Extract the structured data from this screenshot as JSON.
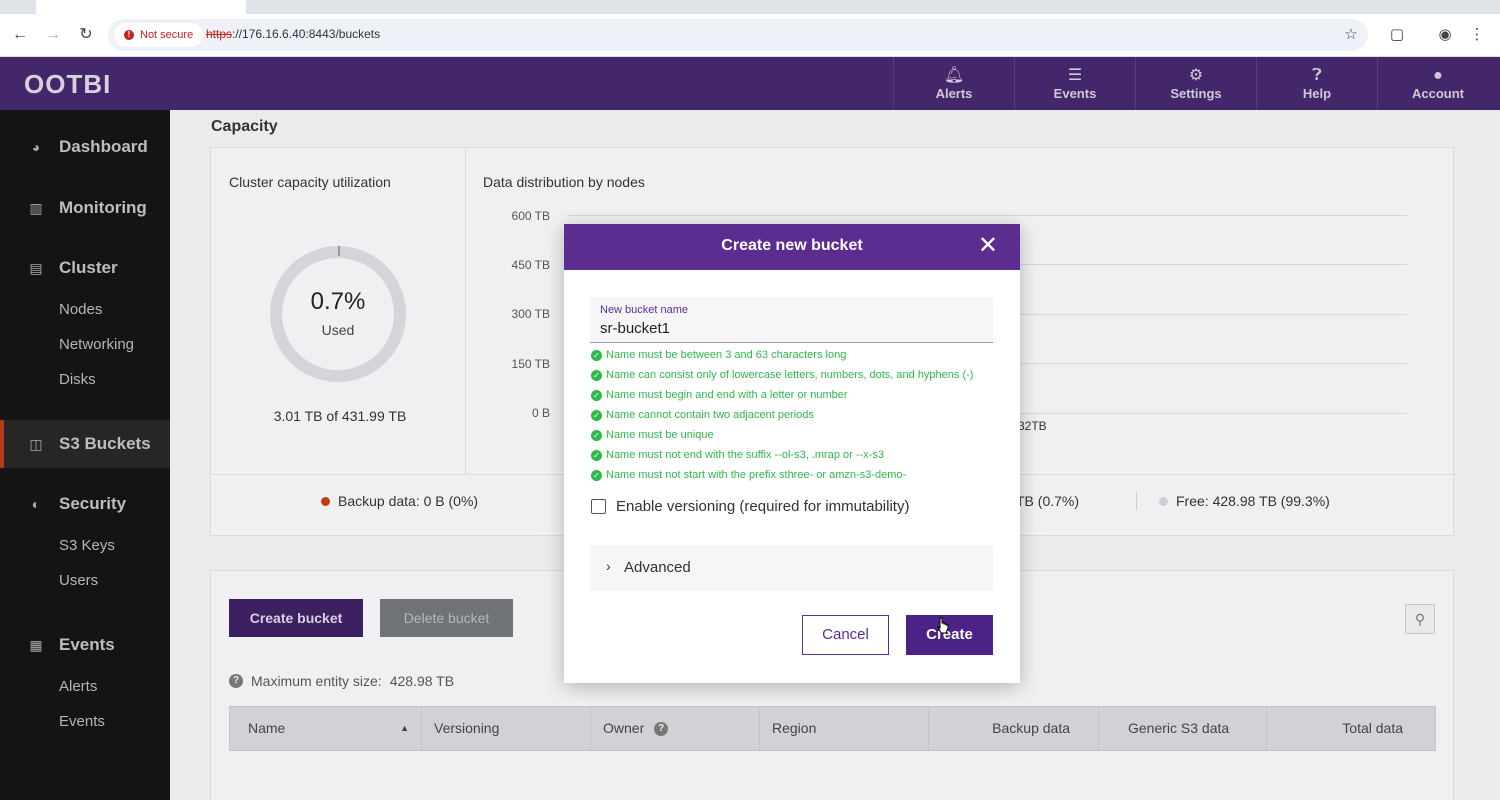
{
  "browser": {
    "not_secure": "Not secure",
    "url_scheme": "https",
    "url_rest": "://176.16.6.40:8443/buckets"
  },
  "app": {
    "logo": "OOTBI",
    "header_items": [
      {
        "label": "Alerts",
        "icon": "bell-icon"
      },
      {
        "label": "Events",
        "icon": "list-icon"
      },
      {
        "label": "Settings",
        "icon": "gear-icon"
      },
      {
        "label": "Help",
        "icon": "help-icon"
      },
      {
        "label": "Account",
        "icon": "user-icon"
      }
    ]
  },
  "sidebar": {
    "dashboard": "Dashboard",
    "monitoring": "Monitoring",
    "cluster": "Cluster",
    "nodes": "Nodes",
    "networking": "Networking",
    "disks": "Disks",
    "s3_buckets": "S3 Buckets",
    "security": "Security",
    "s3_keys": "S3 Keys",
    "users": "Users",
    "events": "Events",
    "alerts": "Alerts",
    "events_sub": "Events"
  },
  "capacity": {
    "title": "Capacity",
    "utilization_label": "Cluster capacity utilization",
    "percent": "0.7%",
    "used_label": "Used",
    "total": "3.01 TB of 431.99 TB",
    "distribution_label": "Data distribution by nodes",
    "y_ticks": [
      "600 TB",
      "450 TB",
      "300 TB",
      "150 TB",
      "0 B"
    ],
    "node_fragment": "32TB",
    "legend_backup": "Backup data: 0 B (0%)",
    "legend_used_fragment": "TB (0.7%)",
    "legend_free": "Free: 428.98 TB (99.3%)",
    "colors": {
      "backup": "#c43a12",
      "free": "#d0ced2"
    }
  },
  "buckets": {
    "create_button": "Create bucket",
    "delete_button": "Delete bucket",
    "max_size_label": "Maximum entity size:",
    "max_size_value": "428.98 TB",
    "columns": [
      "Name",
      "Versioning",
      "Owner",
      "Region",
      "Backup data",
      "Generic S3 data",
      "Total data"
    ]
  },
  "modal": {
    "title": "Create new bucket",
    "field_label": "New bucket name",
    "field_value": "sr-bucket1",
    "rules": [
      "Name must be between 3 and 63 characters long",
      "Name can consist only of lowercase letters, numbers, dots, and hyphens (-)",
      "Name must begin and end with a letter or number",
      "Name cannot contain two adjacent periods",
      "Name must be unique",
      "Name must not end with the suffix --ol-s3, .mrap or --x-s3",
      "Name must not start with the prefix sthree- or amzn-s3-demo-"
    ],
    "versioning_label": "Enable versioning (required for immutability)",
    "advanced_label": "Advanced",
    "cancel_label": "Cancel",
    "create_label": "Create",
    "accent": "#5b2d91"
  }
}
